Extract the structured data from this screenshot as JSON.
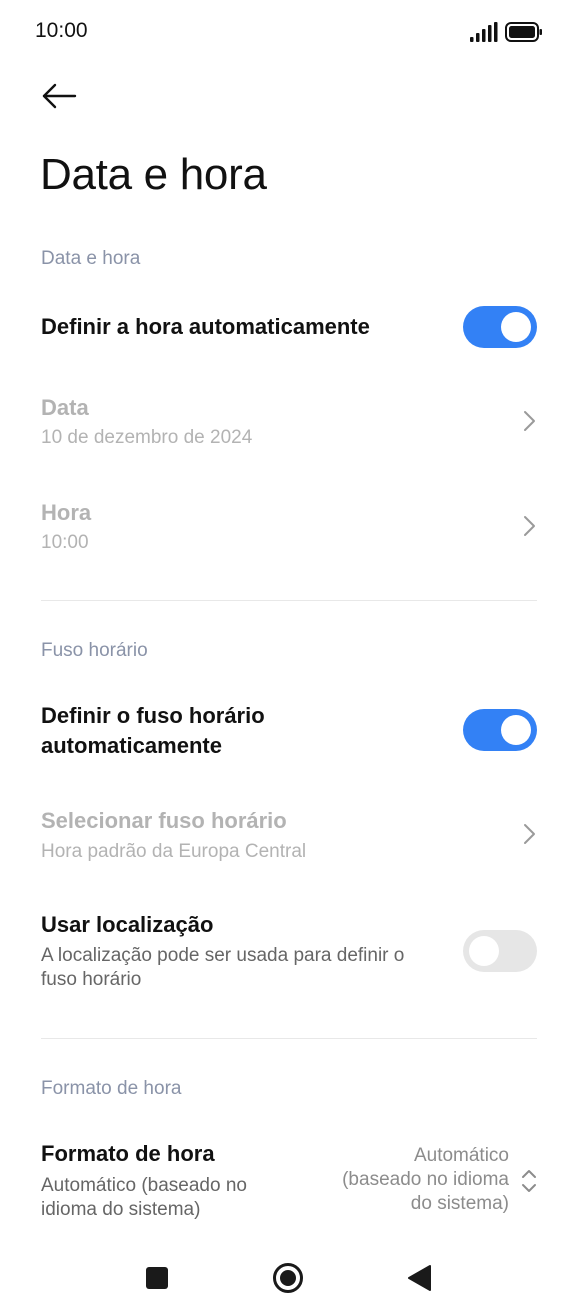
{
  "status_bar": {
    "time": "10:00"
  },
  "header": {
    "title": "Data e hora",
    "back_icon": "arrow-left-icon"
  },
  "sections": {
    "date_time": {
      "header": "Data e hora",
      "auto_time": {
        "label": "Definir a hora automaticamente",
        "enabled": true
      },
      "date": {
        "label": "Data",
        "value": "10 de dezembro de 2024"
      },
      "time": {
        "label": "Hora",
        "value": "10:00"
      }
    },
    "timezone": {
      "header": "Fuso horário",
      "auto_timezone": {
        "label_line1": "Definir o fuso horário",
        "label_line2": "automaticamente",
        "enabled": true
      },
      "select_timezone": {
        "label": "Selecionar fuso horário",
        "value": "Hora padrão da Europa Central"
      },
      "use_location": {
        "label": "Usar localização",
        "desc_line1": "A localização pode ser usada para definir o",
        "desc_line2": "fuso horário",
        "enabled": false
      }
    },
    "time_format": {
      "header": "Formato de hora",
      "format": {
        "label": "Formato de hora",
        "desc_line1": "Automático (baseado no",
        "desc_line2": "idioma do sistema)",
        "value_line1": "Automático",
        "value_line2": "(baseado no idioma",
        "value_line3": "do sistema)"
      }
    }
  },
  "colors": {
    "accent": "#3381f5",
    "toggle_off": "#e6e6e6",
    "section_header": "#8a93a8",
    "disabled_text": "#b3b3b3"
  }
}
